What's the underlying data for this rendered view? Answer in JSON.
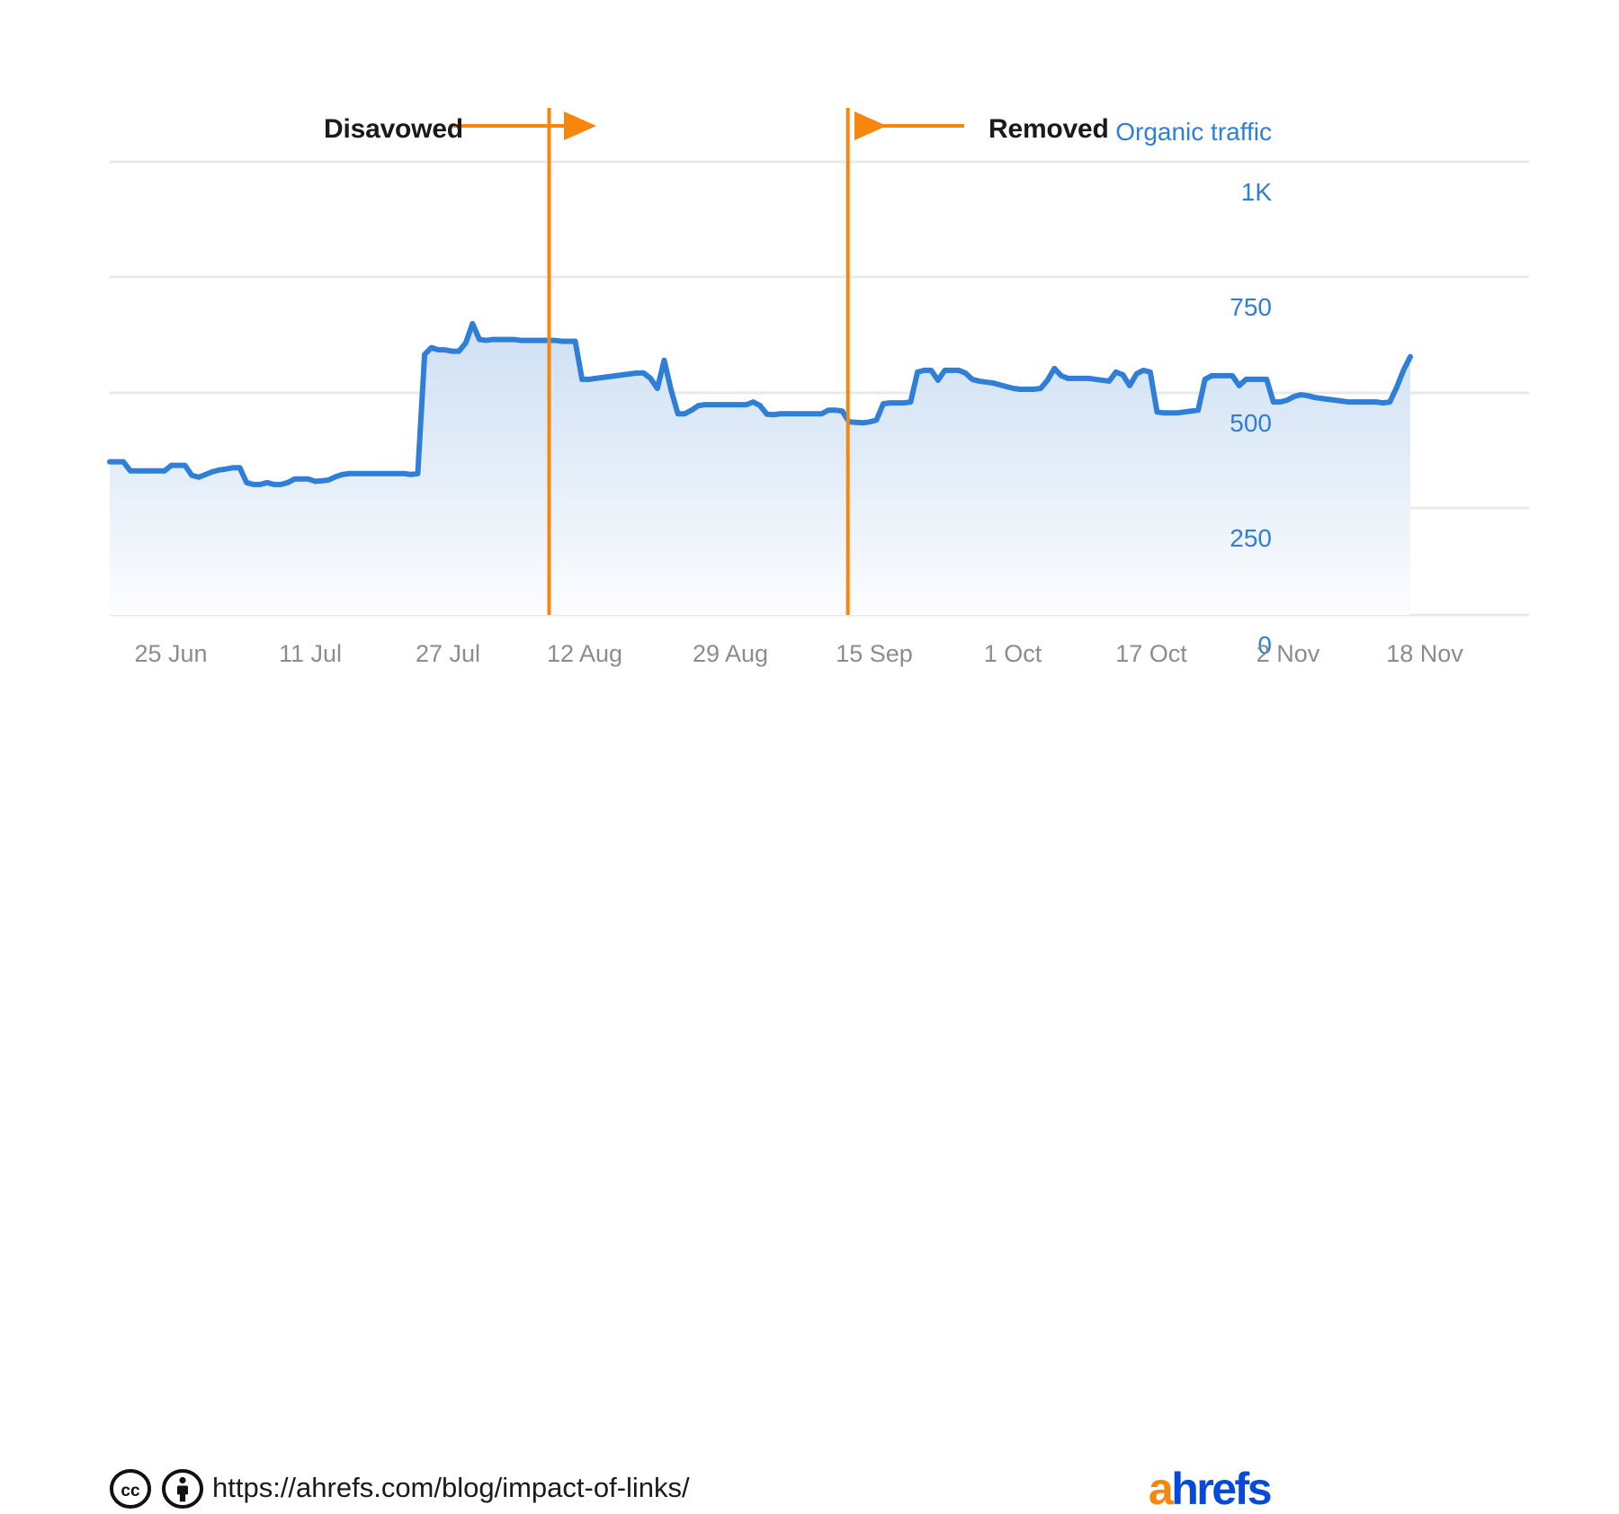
{
  "chart_data": {
    "type": "area",
    "title": "",
    "subtitle": "",
    "xlabel": "",
    "ylabel": "Organic traffic",
    "series_label": "Organic traffic",
    "legend_position": "top-right",
    "grid": true,
    "ylim": [
      0,
      1000
    ],
    "y_ticks": [
      "1K",
      "750",
      "500",
      "250",
      "0"
    ],
    "y_tick_values": [
      1000,
      750,
      500,
      250,
      0
    ],
    "x_ticks": [
      "25 Jun",
      "11 Jul",
      "27 Jul",
      "12 Aug",
      "29 Aug",
      "15 Sep",
      "1 Oct",
      "17 Oct",
      "2 Nov",
      "18 Nov"
    ],
    "x_tick_positions": [
      2,
      18,
      34,
      50,
      67,
      84,
      100,
      116,
      132,
      148
    ],
    "x_start": "25 Jun",
    "x_end": "18 Nov",
    "series": [
      {
        "name": "Organic traffic",
        "color": "#2f7ed8",
        "fill_top_color": "#d3e2f4",
        "fill_bottom_color": "#fbfdff",
        "values": [
          338,
          338,
          338,
          318,
          318,
          318,
          318,
          318,
          318,
          330,
          330,
          330,
          308,
          304,
          310,
          316,
          320,
          322,
          325,
          325,
          292,
          288,
          288,
          292,
          288,
          288,
          292,
          300,
          300,
          300,
          295,
          296,
          298,
          305,
          310,
          312,
          312,
          312,
          312,
          312,
          312,
          312,
          312,
          312,
          310,
          312,
          575,
          590,
          585,
          585,
          582,
          582,
          600,
          643,
          608,
          606,
          608,
          608,
          608,
          608,
          606,
          606,
          606,
          606,
          606,
          606,
          604,
          604,
          604,
          520,
          520,
          522,
          524,
          526,
          528,
          530,
          532,
          534,
          534,
          522,
          500,
          562,
          497,
          444,
          444,
          452,
          462,
          464,
          464,
          464,
          464,
          464,
          464,
          464,
          470,
          462,
          443,
          442,
          444,
          444,
          444,
          444,
          444,
          444,
          444,
          452,
          452,
          450,
          426,
          425,
          424,
          426,
          430,
          466,
          468,
          468,
          468,
          470,
          536,
          540,
          540,
          518,
          540,
          540,
          540,
          534,
          520,
          516,
          514,
          512,
          508,
          504,
          500,
          498,
          498,
          498,
          500,
          518,
          544,
          528,
          522,
          522,
          522,
          522,
          520,
          518,
          516,
          536,
          530,
          506,
          532,
          540,
          536,
          448,
          446,
          446,
          446,
          448,
          450,
          452,
          520,
          528,
          528,
          528,
          528,
          506,
          520,
          520,
          520,
          520,
          470,
          470,
          474,
          482,
          486,
          484,
          480,
          478,
          476,
          474,
          472,
          470,
          470,
          470,
          470,
          470,
          468,
          470,
          502,
          540,
          570
        ]
      }
    ],
    "annotations": [
      {
        "id": "disavowed",
        "label": "Disavowed",
        "arrow_direction": "right",
        "marker_date": "12 Aug",
        "marker_color": "#f7860f"
      },
      {
        "id": "removed",
        "label": "Removed",
        "arrow_direction": "left",
        "marker_date": "15 Sep",
        "marker_color": "#f7860f"
      }
    ]
  },
  "chart": {
    "axis_label_color": "#2f7ed8",
    "x_tick_color": "#8c8c8c",
    "gridline_color": "#e8e8e8",
    "line_color": "#2f7ed8",
    "marker_color": "#f7860f"
  },
  "footer": {
    "source_url": "https://ahrefs.com/blog/impact-of-links/",
    "license": {
      "cc_label": "cc",
      "by_label": "by"
    },
    "brand": {
      "prefix": "a",
      "suffix": "hrefs"
    }
  }
}
